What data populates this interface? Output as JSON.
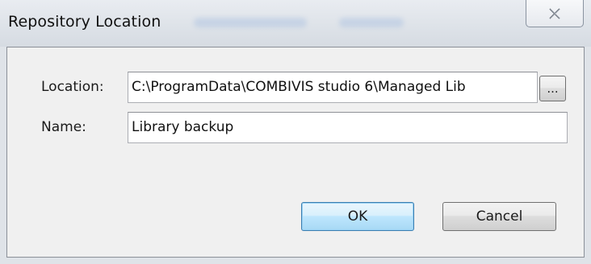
{
  "window": {
    "title": "Repository Location"
  },
  "titlebar": {
    "close_icon": "close-icon"
  },
  "form": {
    "location_label": "Location:",
    "location_value": "C:\\ProgramData\\COMBIVIS studio 6\\Managed Lib",
    "browse_label": "...",
    "name_label": "Name:",
    "name_value": "Library backup"
  },
  "buttons": {
    "ok_label": "OK",
    "cancel_label": "Cancel"
  },
  "colors": {
    "ok_border": "#3c7fb1",
    "ok_fill": "#bee6fd",
    "dialog_bg": "#f0f0f0",
    "titlebar_bg": "#dde2e8"
  }
}
